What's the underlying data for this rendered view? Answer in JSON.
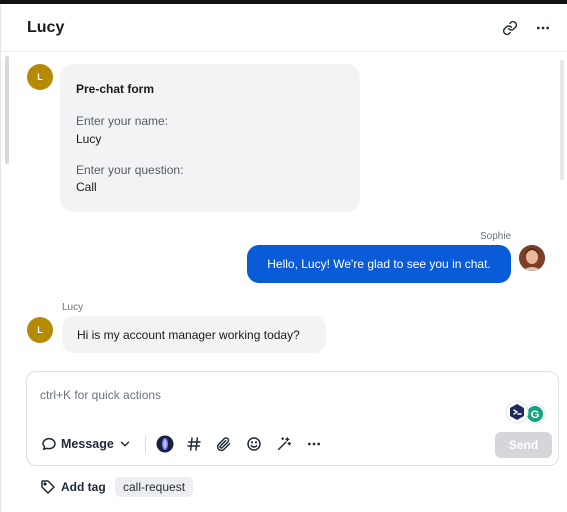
{
  "header": {
    "title": "Lucy",
    "link_icon": "link-icon",
    "more_icon": "more-horizontal-icon"
  },
  "messages": [
    {
      "type": "form",
      "avatar_initial": "L",
      "title": "Pre-chat form",
      "fields": [
        {
          "question": "Enter your name:",
          "answer": "Lucy"
        },
        {
          "question": "Enter your question:",
          "answer": "Call"
        }
      ]
    },
    {
      "type": "outgoing",
      "sender": "Sophie",
      "text": "Hello, Lucy! We're glad to see you in chat."
    },
    {
      "type": "incoming",
      "sender": "Lucy",
      "avatar_initial": "L",
      "text": "Hi is my account manager working today?"
    }
  ],
  "composer": {
    "placeholder": "ctrl+K for quick actions",
    "message_type_label": "Message",
    "send_label": "Send",
    "toolbar_icons": [
      "ai-assistant-icon",
      "hashtag-icon",
      "paperclip-icon",
      "emoji-icon",
      "magic-wand-icon",
      "more-horizontal-icon"
    ]
  },
  "tags": {
    "add_tag_label": "Add tag",
    "items": [
      "call-request"
    ]
  },
  "colors": {
    "accent": "#0a5bd8",
    "avatar_bg": "#b48a06",
    "bubble_in": "#f2f3f5",
    "send_disabled": "#d4d6da"
  }
}
